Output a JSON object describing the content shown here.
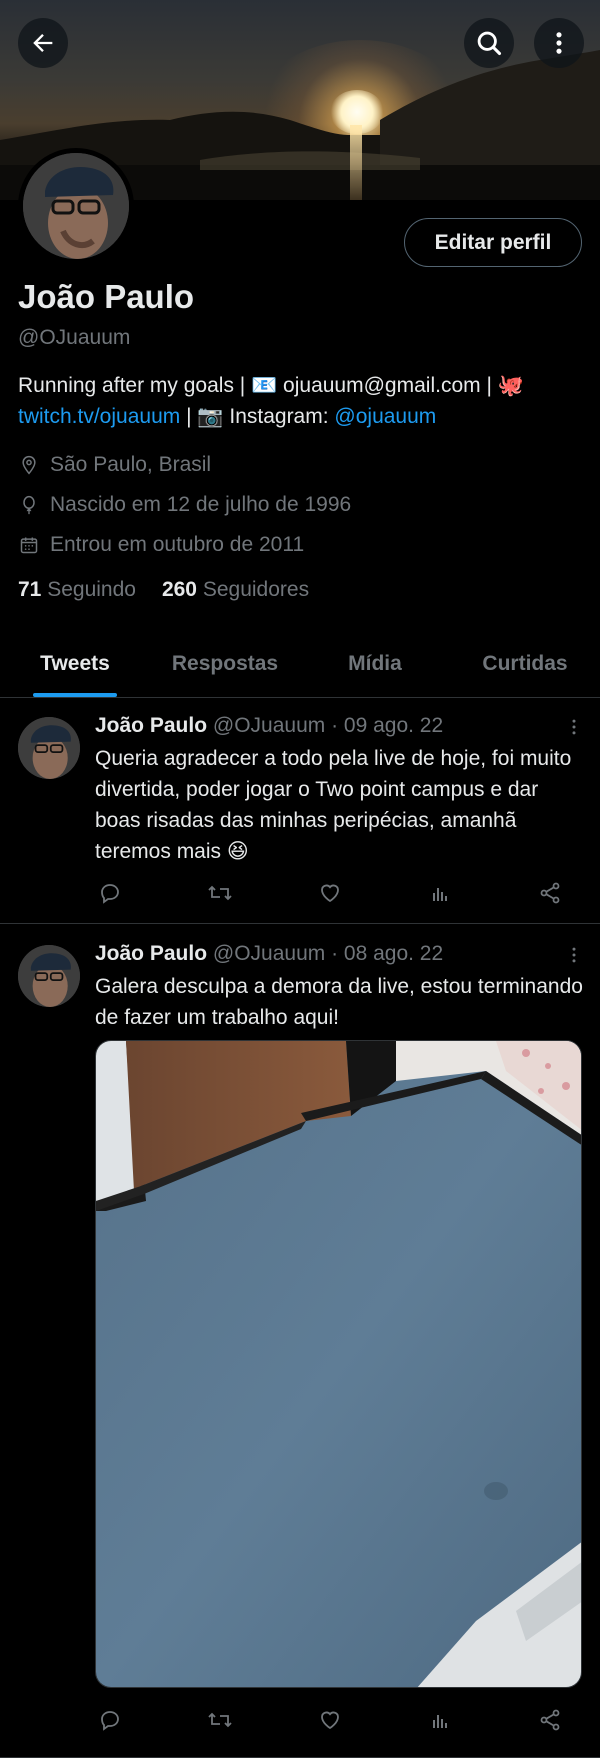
{
  "header": {
    "back_icon": "arrow-left-icon",
    "search_icon": "search-icon",
    "more_icon": "more-vertical-icon"
  },
  "profile": {
    "name": "João Paulo",
    "handle": "@OJuauum",
    "edit_button": "Editar perfil",
    "bio_line1_text": "Running after my goals | 📧 ojuauum@gmail.com | 🐙",
    "bio_line2_link1": "twitch.tv/ojuauum",
    "bio_line2_mid": " | 📷 Instagram: ",
    "bio_line2_link2": "@ojuauum",
    "location": "São Paulo, Brasil",
    "birthday": "Nascido em 12 de julho de 1996",
    "joined": "Entrou em outubro de 2011",
    "following_count": "71",
    "following_label": "Seguindo",
    "followers_count": "260",
    "followers_label": "Seguidores"
  },
  "tabs": [
    {
      "label": "Tweets",
      "active": true
    },
    {
      "label": "Respostas",
      "active": false
    },
    {
      "label": "Mídia",
      "active": false
    },
    {
      "label": "Curtidas",
      "active": false
    }
  ],
  "tweets": [
    {
      "name": "João Paulo",
      "meta": "@OJuauum · 09 ago. 22",
      "text": "Queria agradecer a todo pela live de hoje, foi muito divertida, poder jogar o Two point campus e dar boas risadas das minhas peripécias, amanhã teremos mais 😆"
    },
    {
      "name": "João Paulo",
      "meta": "@OJuauum · 08 ago. 22",
      "text": "Galera desculpa a demora da live, estou terminando de fazer um trabalho aqui!"
    }
  ],
  "colors": {
    "accent": "#1d9bf0",
    "text_primary": "#e7e9ea",
    "text_secondary": "#71767b",
    "divider": "#2f3336",
    "background": "#000000"
  }
}
